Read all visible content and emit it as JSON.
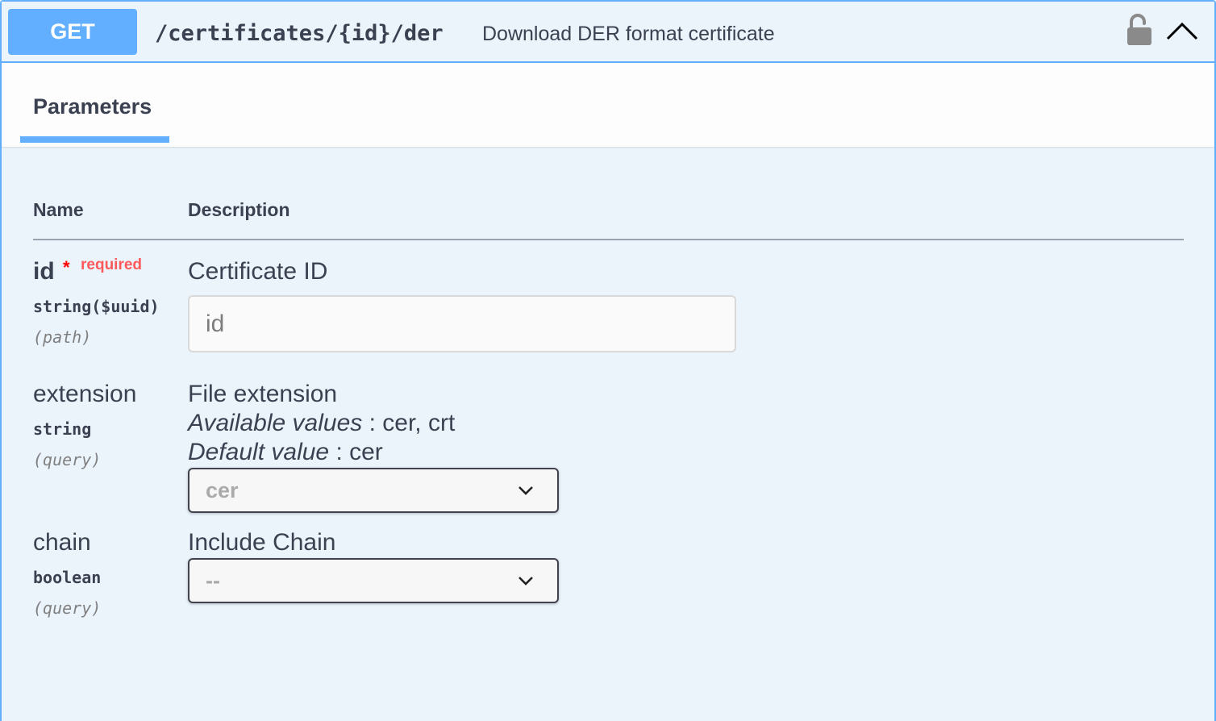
{
  "endpoint": {
    "method": "GET",
    "path": "/certificates/{id}/der",
    "summary": "Download DER format certificate",
    "icons": {
      "lock": "unlocked-padlock-icon",
      "collapse": "chevron-up-icon"
    }
  },
  "tabs": {
    "parameters": "Parameters"
  },
  "table": {
    "name_header": "Name",
    "description_header": "Description"
  },
  "params": [
    {
      "name": "id",
      "required_star": "*",
      "required_label": "required",
      "type": "string($uuid)",
      "in": "(path)",
      "description": "Certificate ID",
      "input_placeholder": "id"
    },
    {
      "name": "extension",
      "type": "string",
      "in": "(query)",
      "description": "File extension",
      "available_label": "Available values",
      "available_values": " : cer, crt",
      "default_label": "Default value",
      "default_value": " : cer",
      "selected": "cer"
    },
    {
      "name": "chain",
      "type": "boolean",
      "in": "(query)",
      "description": "Include Chain",
      "selected": "--"
    }
  ],
  "colors": {
    "accent": "#61affe",
    "background": "#ebf3fb",
    "required": "#ff0000"
  }
}
